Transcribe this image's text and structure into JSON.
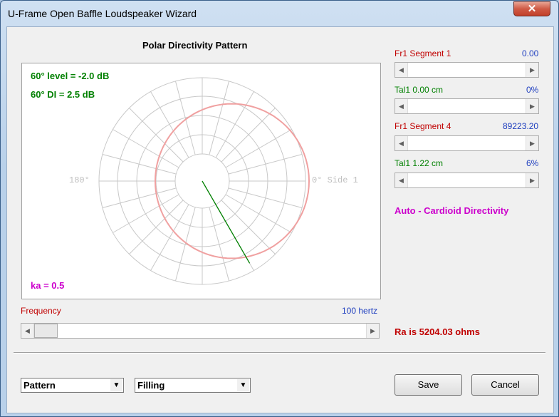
{
  "window": {
    "title": "U-Frame Open Baffle Loudspeaker Wizard",
    "close_glyph": "✕"
  },
  "plot": {
    "title": "Polar Directivity Pattern",
    "level_text": "60° level = -2.0 dB",
    "di_text": "60° DI = 2.5 dB",
    "ka_text": "ka = 0.5",
    "label_left": "180°",
    "label_right": "0° Side 1",
    "pattern_color": "#f0a0a0",
    "pointer_color": "#008000",
    "grid_color": "#c8c8c8"
  },
  "frequency": {
    "label": "Frequency",
    "value_text": "100 hertz",
    "slider_fraction": 0.03
  },
  "controls": [
    {
      "label": "Fr1  Segment 1",
      "value": "0.00",
      "label_color": "red",
      "slider_fraction": 0.0
    },
    {
      "label": "Tal1  0.00 cm",
      "value": "0%",
      "label_color": "green",
      "slider_fraction": 0.0
    },
    {
      "label": "Fr1  Segment 4",
      "value": "89223.20",
      "label_color": "red",
      "slider_fraction": 0.0
    },
    {
      "label": "Tal1  1.22 cm",
      "value": "6%",
      "label_color": "green",
      "slider_fraction": 0.0
    }
  ],
  "mode_text": "Auto - Cardioid Directivity",
  "ra_text": "Ra is 5204.03 ohms",
  "bottom": {
    "combo1": {
      "value": "Pattern"
    },
    "combo2": {
      "value": "Filling"
    },
    "save_label": "Save",
    "cancel_label": "Cancel"
  },
  "colors": {
    "red": "#c00000",
    "green": "#008000",
    "blue": "#1f3fbf",
    "magenta": "#cc00cc"
  }
}
